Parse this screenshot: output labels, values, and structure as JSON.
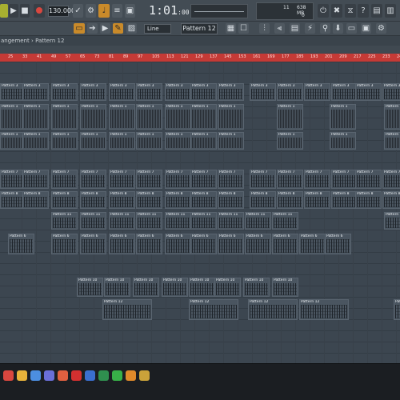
{
  "toolbar": {
    "tempo": "130.000",
    "time_main": "1:01",
    "time_sub": ":00",
    "cpu_voices": "11",
    "cpu_memory": "638 MB",
    "cpu_zero": "0"
  },
  "toolbar2": {
    "snap": "Line",
    "pattern_select": "Pattern 12"
  },
  "playlist": {
    "breadcrumb_prefix": "angement",
    "breadcrumb_sep": "›",
    "breadcrumb_pattern": "Pattern 12"
  },
  "ruler": {
    "ticks": [
      "25",
      "33",
      "41",
      "49",
      "57",
      "65",
      "73",
      "81",
      "89",
      "97",
      "105",
      "113",
      "121",
      "129",
      "137",
      "145",
      "153",
      "161",
      "169",
      "177",
      "185",
      "193",
      "201",
      "209",
      "217",
      "225",
      "233",
      "241"
    ]
  },
  "colors": {
    "ruler": "#c53a36",
    "accent_orange": "#c98a2a",
    "clip": "#4a5560",
    "background": "#3c4650",
    "taskbar": "#1b1e22"
  },
  "clip_labels": {
    "p1": "Pattern 1",
    "p3": "Pattern 3",
    "p5": "Pattern 5",
    "p6": "Pattern 6",
    "p7": "Pattern 7",
    "p8": "Pattern 8",
    "p10": "Pattern 10",
    "p11": "Pattern 11",
    "p12": "Pattern 12",
    "p9": "Pattern 9"
  },
  "taskbar_icons": [
    "app-icon",
    "chrome-icon",
    "firefox-icon",
    "discord-icon",
    "droplet-icon",
    "opera-icon",
    "word-icon",
    "excel-icon",
    "whatsapp-icon",
    "fl-studio-icon",
    "explorer-icon"
  ]
}
